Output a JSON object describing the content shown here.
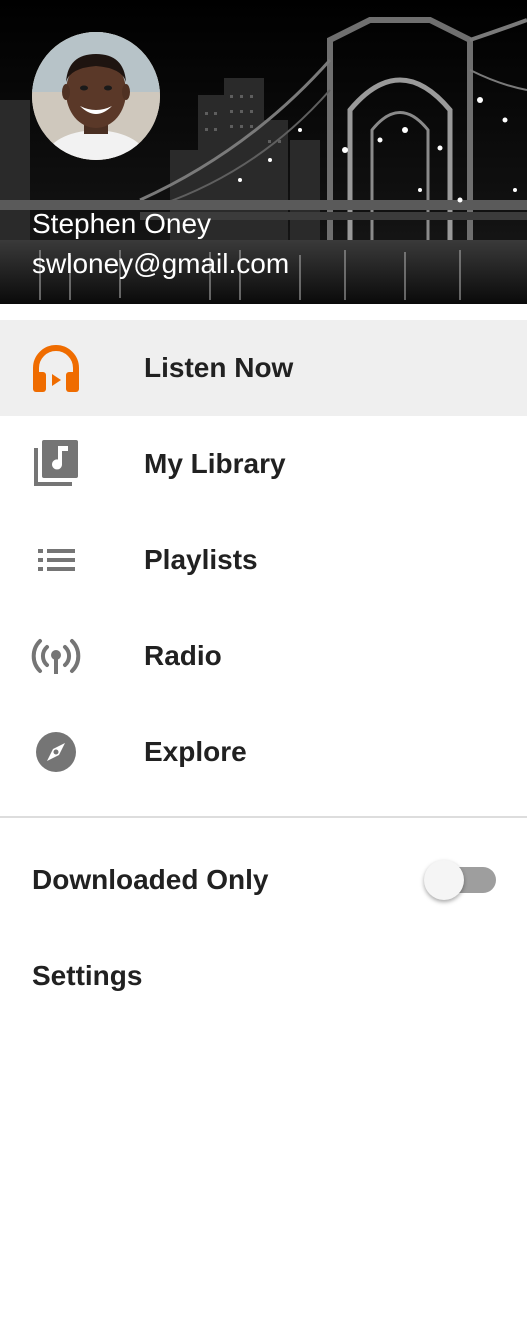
{
  "header": {
    "user_name": "Stephen Oney",
    "user_email": "swloney@gmail.com"
  },
  "nav": {
    "items": [
      {
        "label": "Listen Now",
        "icon": "headphones-icon",
        "active": true
      },
      {
        "label": "My Library",
        "icon": "music-library-icon",
        "active": false
      },
      {
        "label": "Playlists",
        "icon": "playlist-icon",
        "active": false
      },
      {
        "label": "Radio",
        "icon": "radio-icon",
        "active": false
      },
      {
        "label": "Explore",
        "icon": "compass-icon",
        "active": false
      }
    ]
  },
  "settings": {
    "downloaded_only_label": "Downloaded Only",
    "downloaded_only_enabled": false,
    "settings_label": "Settings"
  },
  "colors": {
    "accent": "#ef6c00",
    "icon_gray": "#757575",
    "active_bg": "#efefef",
    "text": "#212121"
  }
}
